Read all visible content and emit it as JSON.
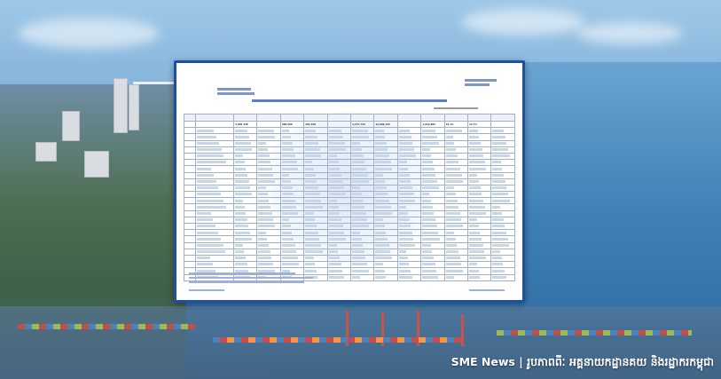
{
  "document": {
    "total_row_values": [
      "4,005,438",
      "388,689",
      "491,546",
      "3,137,733",
      "12,966,125",
      "1,016,883",
      "16.1%",
      "13.7%"
    ]
  },
  "caption": {
    "brand": "SME News",
    "separator": " | ",
    "credit": "រូបភាពពីៈ អគ្គនាយកដ្ឋានគយ និងរដ្ឋាករកម្ពុជា"
  }
}
